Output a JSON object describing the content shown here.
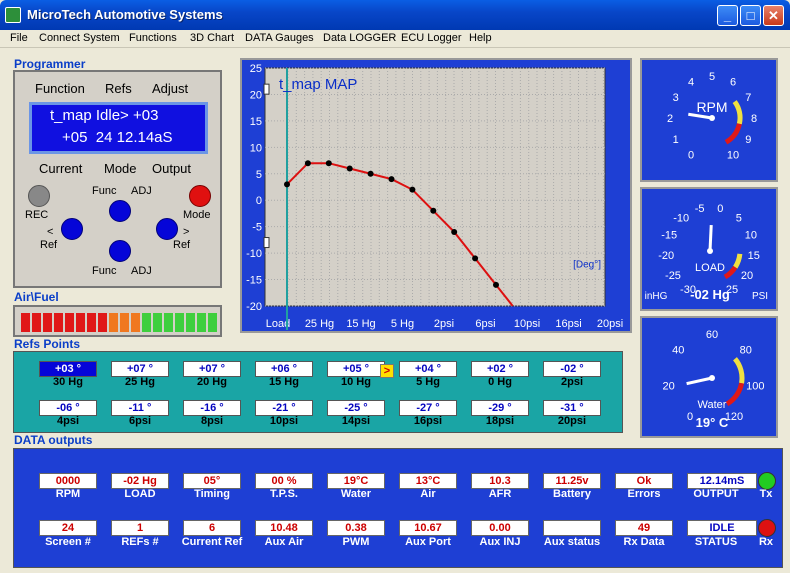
{
  "window": {
    "title": "MicroTech Automotive Systems",
    "min": "_",
    "max": "□",
    "close": "✕"
  },
  "menu": [
    "File",
    "Connect System",
    "Functions",
    "3D Chart",
    "DATA Gauges",
    "Data LOGGER",
    "ECU Logger",
    "Help"
  ],
  "programmer": {
    "title": "Programmer",
    "headers": [
      "Function",
      "Refs",
      "Adjust"
    ],
    "lcd_line1": "t_map Idle> +03",
    "lcd_line2": "+05  24 12.14aS",
    "row_labels": [
      "Current",
      "Mode",
      "Output"
    ],
    "labels": {
      "rec": "REC",
      "func_top": "Func",
      "adj_top": "ADJ",
      "mode": "Mode",
      "ref_left": "Ref",
      "ref_right": "Ref",
      "func_bottom": "Func",
      "adj_bottom": "ADJ",
      "left_arrow": "<",
      "right_arrow": ">"
    }
  },
  "airfuel": {
    "title": "Air\\Fuel",
    "segments": [
      "#e01818",
      "#e01818",
      "#e01818",
      "#e01818",
      "#e01818",
      "#e01818",
      "#e01818",
      "#e01818",
      "#f07820",
      "#f07820",
      "#f07820",
      "#3ecf3e",
      "#3ecf3e",
      "#3ecf3e",
      "#3ecf3e",
      "#3ecf3e",
      "#3ecf3e",
      "#3ecf3e"
    ]
  },
  "chart_data": {
    "type": "line",
    "title": "t_map MAP",
    "unit_label": "[Deg°]",
    "x_tick_labels": [
      "Load",
      "25 Hg",
      "15 Hg",
      "5 Hg",
      "2psi",
      "6psi",
      "10psi",
      "16psi",
      "20psi"
    ],
    "ylim": [
      -20,
      25
    ],
    "y_ticks": [
      25,
      20,
      15,
      10,
      5,
      0,
      -5,
      -10,
      -15,
      -20
    ],
    "x": [
      "30 Hg",
      "25 Hg",
      "20 Hg",
      "15 Hg",
      "10 Hg",
      "5 Hg",
      "0 Hg",
      "2psi",
      "4psi",
      "6psi",
      "8psi",
      "10psi"
    ],
    "values": [
      3,
      7,
      7,
      6,
      5,
      4,
      2,
      -2,
      -6,
      -11,
      -16,
      -21
    ],
    "grid": true,
    "line_color": "#dd1010"
  },
  "gauges": {
    "rpm": {
      "label": "RPM",
      "ticks": [
        "0",
        "1",
        "2",
        "3",
        "4",
        "5",
        "6",
        "7",
        "8",
        "9",
        "10"
      ],
      "value": 2.3
    },
    "load": {
      "label": "LOAD",
      "ticks": [
        "-30",
        "-25",
        "-20",
        "-15",
        "-10",
        "-5",
        "0",
        "5",
        "10",
        "15",
        "20",
        "25"
      ],
      "value": -2,
      "left_unit": "inHG",
      "right_unit": "PSI",
      "readout": "-02 Hg"
    },
    "water": {
      "label": "Water",
      "ticks": [
        "0",
        "20",
        "40",
        "60",
        "80",
        "100",
        "120"
      ],
      "value": 19,
      "readout": "19° C"
    }
  },
  "refs": {
    "title": "Refs Points",
    "row1": [
      {
        "v": "+03 °",
        "l": "30 Hg"
      },
      {
        "v": "+07 °",
        "l": "25 Hg"
      },
      {
        "v": "+07 °",
        "l": "20 Hg"
      },
      {
        "v": "+06 °",
        "l": "15 Hg"
      },
      {
        "v": "+05 °",
        "l": "10 Hg"
      },
      {
        "v": "+04 °",
        "l": "5 Hg"
      },
      {
        "v": "+02 °",
        "l": "0 Hg"
      },
      {
        "v": "-02 °",
        "l": "2psi"
      }
    ],
    "row2": [
      {
        "v": "-06 °",
        "l": "4psi"
      },
      {
        "v": "-11 °",
        "l": "6psi"
      },
      {
        "v": "-16 °",
        "l": "8psi"
      },
      {
        "v": "-21 °",
        "l": "10psi"
      },
      {
        "v": "-25 °",
        "l": "14psi"
      },
      {
        "v": "-27 °",
        "l": "16psi"
      },
      {
        "v": "-29 °",
        "l": "18psi"
      },
      {
        "v": "-31 °",
        "l": "20psi"
      }
    ],
    "pointer": ">"
  },
  "data_outputs": {
    "title": "DATA outputs",
    "row1": [
      {
        "v": "0000",
        "l": "RPM"
      },
      {
        "v": "-02 Hg",
        "l": "LOAD"
      },
      {
        "v": "05°",
        "l": "Timing"
      },
      {
        "v": "00 %",
        "l": "T.P.S."
      },
      {
        "v": "19°C",
        "l": "Water"
      },
      {
        "v": "13°C",
        "l": "Air"
      },
      {
        "v": "10.3",
        "l": "AFR"
      },
      {
        "v": "11.25v",
        "l": "Battery"
      },
      {
        "v": "Ok",
        "l": "Errors"
      },
      {
        "v": "12.14mS",
        "l": "OUTPUT"
      }
    ],
    "row2": [
      {
        "v": "24",
        "l": "Screen #"
      },
      {
        "v": "1",
        "l": "REFs #"
      },
      {
        "v": "6",
        "l": "Current Ref"
      },
      {
        "v": "10.48",
        "l": "Aux Air"
      },
      {
        "v": "0.38",
        "l": "PWM"
      },
      {
        "v": "10.67",
        "l": "Aux Port"
      },
      {
        "v": "0.00",
        "l": "Aux INJ"
      },
      {
        "v": "",
        "l": "Aux status"
      },
      {
        "v": "49",
        "l": "Rx Data"
      },
      {
        "v": "IDLE",
        "l": "STATUS"
      }
    ],
    "tx": "Tx",
    "rx": "Rx",
    "tx_color": "#22cc22",
    "rx_color": "#dd1111"
  }
}
